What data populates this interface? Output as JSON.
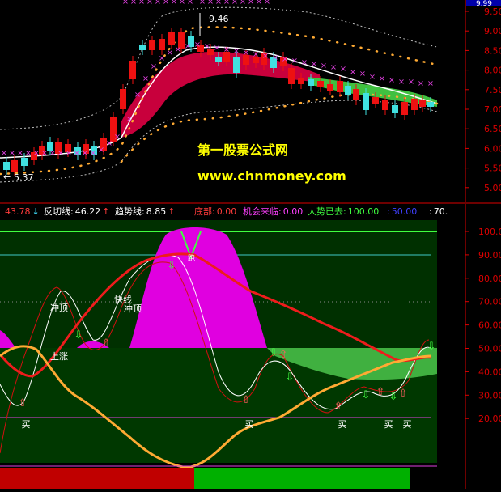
{
  "price_panel": {
    "high_label": "9.46",
    "low_label": "5.37",
    "top_badge": "9.99",
    "axis_ticks": [
      "9.50",
      "9.00",
      "8.50",
      "8.00",
      "7.50",
      "7.00",
      "6.50",
      "6.00",
      "5.50",
      "5.00"
    ]
  },
  "watermark": {
    "line1": "第一股票公式网",
    "line2": "www.chnmoney.com"
  },
  "indicator_bar": {
    "items": [
      {
        "label": "",
        "value": "43.78",
        "arrow": "↓",
        "color": "#ff3b3b"
      },
      {
        "label": "反切线:",
        "value": "46.22",
        "arrow": "↑",
        "color": "#ffffff"
      },
      {
        "label": "趋势线:",
        "value": "8.85",
        "arrow": "↑",
        "color": "#ffffff"
      },
      {
        "label": "底部:",
        "value": "0.00",
        "arrow": "",
        "color": "#ff3b3b"
      },
      {
        "label": "机会来临:",
        "value": "0.00",
        "arrow": "",
        "color": "#ff40ff"
      },
      {
        "label": "大势已去:",
        "value": "100.00",
        "arrow": "",
        "color": "#40ff40"
      },
      {
        "label": ":",
        "value": "50.00",
        "arrow": "",
        "color": "#4040ff"
      },
      {
        "label": ":",
        "value": "70.",
        "arrow": "",
        "color": "#ffffff"
      }
    ]
  },
  "oscillator": {
    "axis_ticks": [
      "100.00",
      "90.00",
      "80.00",
      "70.00",
      "60.00",
      "50.00",
      "40.00",
      "30.00",
      "20.00"
    ],
    "annotations": {
      "chongding_1": "冲顶",
      "kuaixian": "快线",
      "chongding_2": "冲顶",
      "shangzhang": "上涨",
      "pao": "跑"
    },
    "buy_label": "买",
    "colors": {
      "panel_bg": "#003800",
      "magenta": "#e000e0",
      "green_band": "#40c040",
      "red_line": "#ff2020",
      "orange_line": "#ffaa33",
      "white_line": "#ffffff"
    }
  }
}
